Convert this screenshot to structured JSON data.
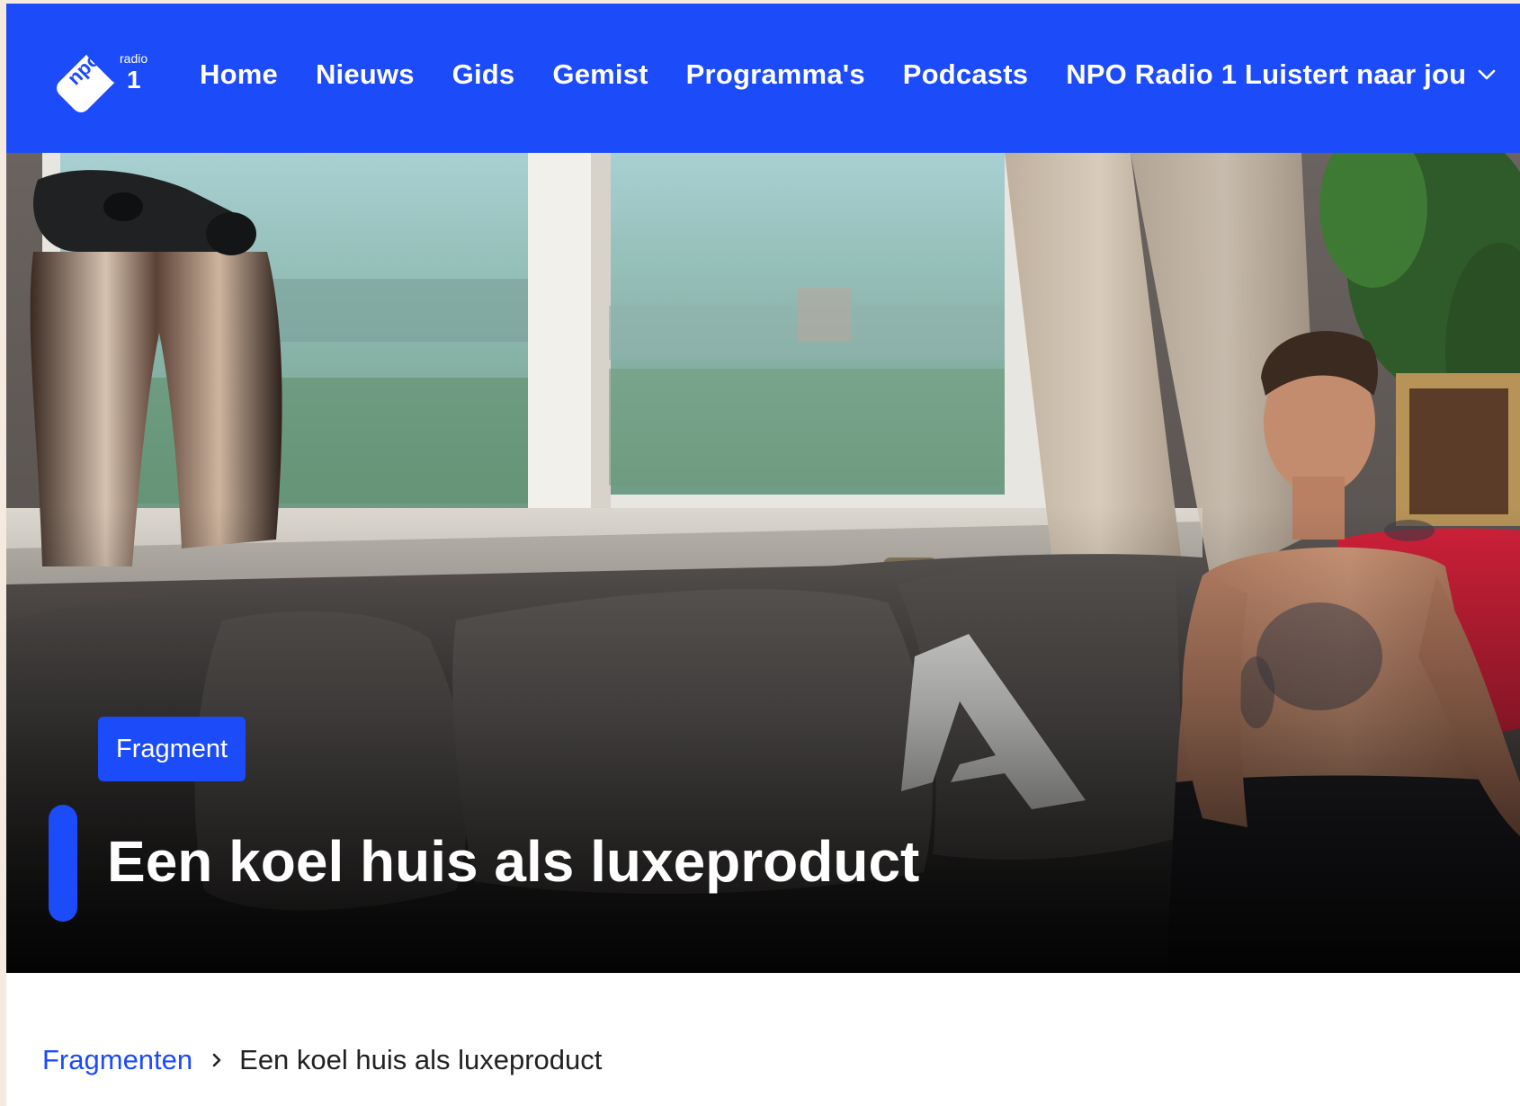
{
  "nav": {
    "logo": {
      "icon": "npo-radio-1-logo",
      "text_npo": "npo",
      "text_radio": "radio",
      "text_number": "1"
    },
    "items": [
      {
        "label": "Home"
      },
      {
        "label": "Nieuws"
      },
      {
        "label": "Gids"
      },
      {
        "label": "Gemist"
      },
      {
        "label": "Programma's"
      },
      {
        "label": "Podcasts"
      },
      {
        "label": "NPO Radio 1 Luistert naar jou",
        "icon": "chevron-down-icon"
      }
    ]
  },
  "hero": {
    "image": "photo of shirtless tattooed man sitting on a grey sofa in a living room with windows and a chrome sculpture",
    "badge": "Fragment",
    "title": "Een koel huis als luxeproduct"
  },
  "breadcrumb": {
    "parent": "Fragmenten",
    "separator_icon": "chevron-right-icon",
    "current": "Een koel huis als luxeproduct"
  },
  "colors": {
    "brand_blue": "#1c4bfa",
    "page_background": "#f6e9dd",
    "text_dark": "#222222"
  }
}
